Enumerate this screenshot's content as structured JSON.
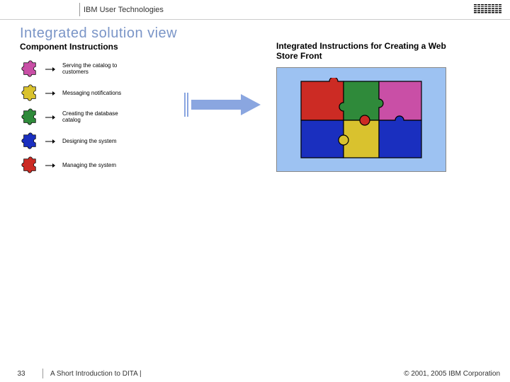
{
  "header": {
    "org": "IBM User Technologies"
  },
  "title": "Integrated solution view",
  "left": {
    "heading": "Component Instructions",
    "items": [
      {
        "label": "Serving the catalog to customers",
        "color": "#c94fa6"
      },
      {
        "label": "Messaging notifications",
        "color": "#d9c22e"
      },
      {
        "label": "Creating the database catalog",
        "color": "#2f8a3a"
      },
      {
        "label": "Designing the system",
        "color": "#1a2fbf"
      },
      {
        "label": "Managing the system",
        "color": "#cc2b24"
      }
    ]
  },
  "right": {
    "heading": "Integrated Instructions for Creating a Web Store Front"
  },
  "footer": {
    "page": "33",
    "title": "A Short Introduction to DITA |",
    "copyright": "© 2001, 2005 IBM Corporation"
  }
}
